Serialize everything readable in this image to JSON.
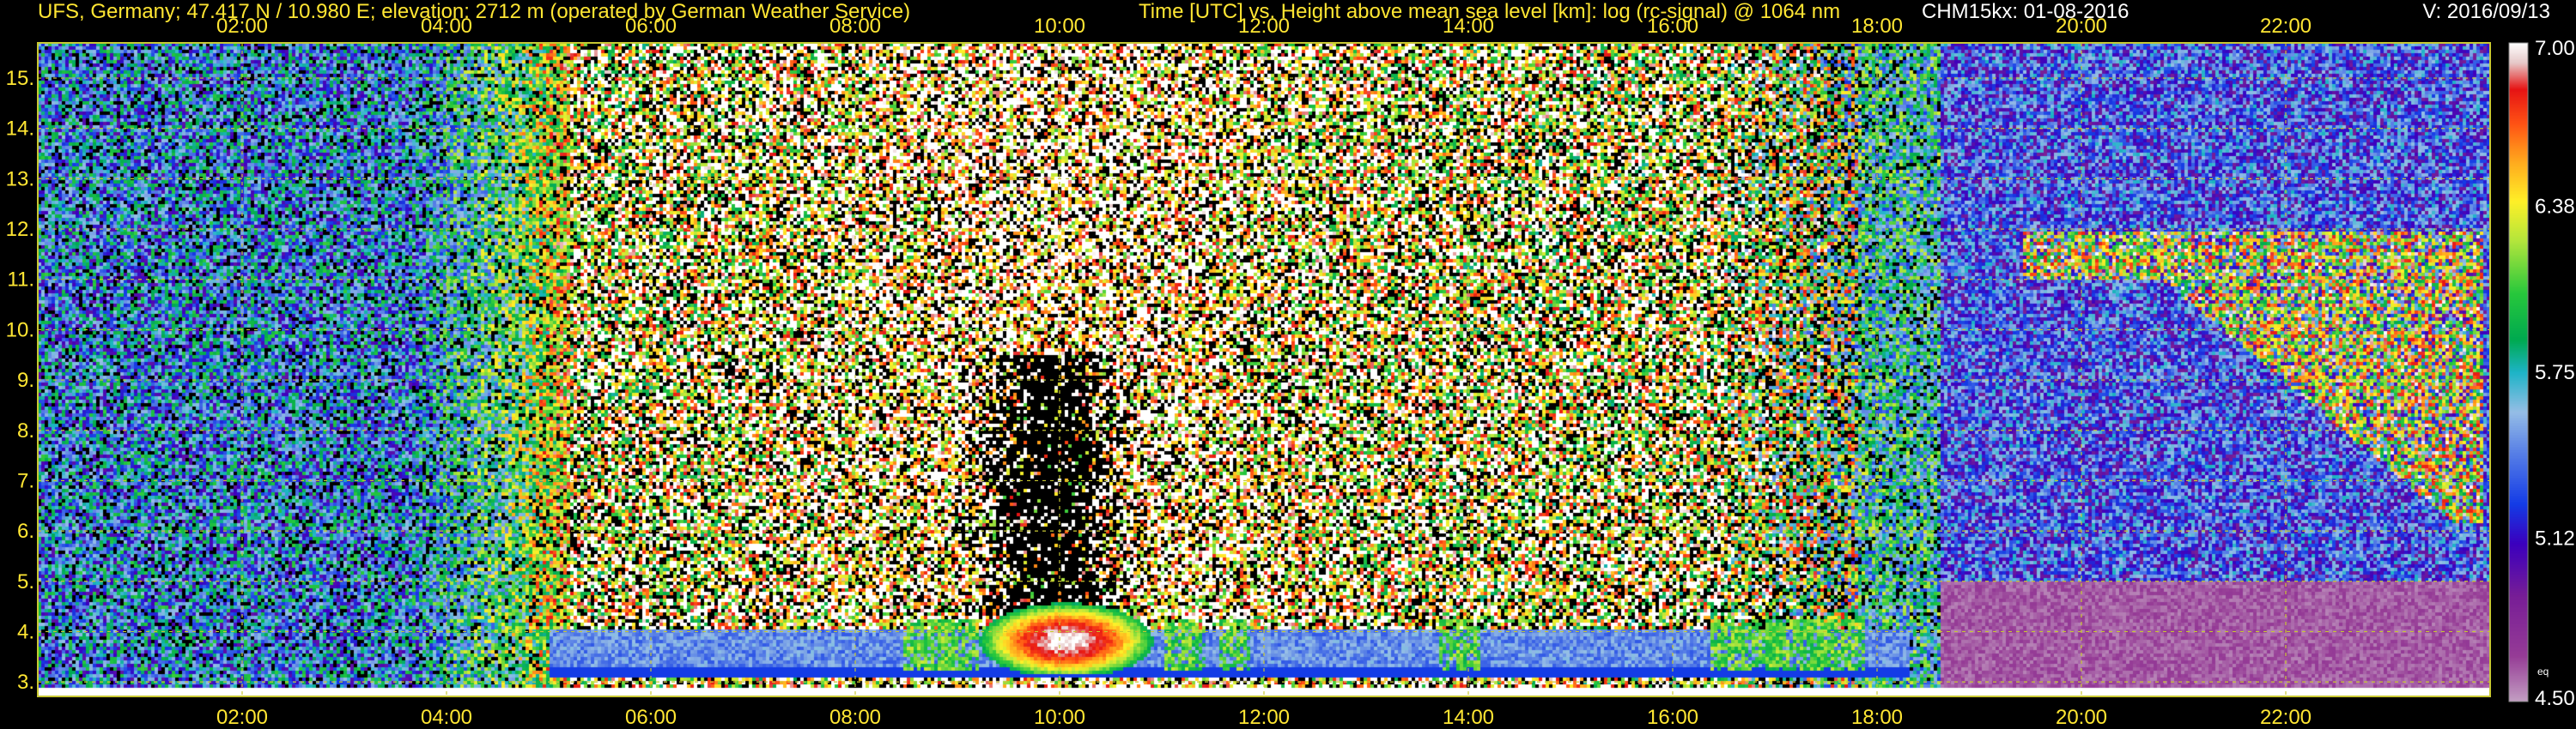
{
  "header": {
    "site": "UFS, Germany; 47.417 N / 10.980 E; elevation: 2712 m  (operated by German Weather Service)",
    "description": "Time [UTC] vs. Height above mean sea level [km]: log (rc-signal) @ 1064 nm",
    "instrument": "CHM15kx: 01-08-2016",
    "version": "V: 2016/09/13"
  },
  "colors": {
    "axis_label": "#ffe633",
    "grid": "#c8c832",
    "frame": "#c8c832",
    "background": "#000000",
    "colorbar_text": "#ffffff"
  },
  "chart_data": {
    "type": "heatmap",
    "x_ticks": [
      "02:00",
      "04:00",
      "06:00",
      "08:00",
      "10:00",
      "12:00",
      "14:00",
      "16:00",
      "18:00",
      "20:00",
      "22:00"
    ],
    "x_tick_hours": [
      2,
      4,
      6,
      8,
      10,
      12,
      14,
      16,
      18,
      20,
      22
    ],
    "xlim_hours": [
      0,
      24
    ],
    "y_ticks": [
      "3.",
      "4.",
      "5.",
      "6.",
      "7.",
      "8.",
      "9.",
      "10.",
      "11.",
      "12.",
      "13.",
      "14.",
      "15."
    ],
    "y_tick_values": [
      3,
      4,
      5,
      6,
      7,
      8,
      9,
      10,
      11,
      12,
      13,
      14,
      15
    ],
    "ylim_km": [
      2.712,
      15.7
    ],
    "grid": true,
    "colorbar": {
      "ticks": [
        "7.00",
        "6.38",
        "5.75",
        "5.12",
        "4.50"
      ],
      "tick_values": [
        7.0,
        6.38,
        5.75,
        5.12,
        4.5
      ],
      "range": [
        4.5,
        7.0
      ],
      "small_label": "eq",
      "small_label_value": 4.62
    }
  }
}
